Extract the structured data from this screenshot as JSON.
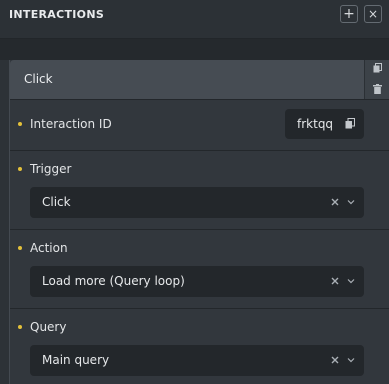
{
  "panel": {
    "title": "INTERACTIONS",
    "add_icon": "plus-icon",
    "close_icon": "close-icon"
  },
  "interaction": {
    "header_label": "Click",
    "copy_icon": "copy-icon",
    "delete_icon": "trash-icon",
    "id_field": {
      "label": "Interaction ID",
      "value": "frktqq",
      "icon": "copy-icon"
    },
    "trigger": {
      "label": "Trigger",
      "value": "Click"
    },
    "action": {
      "label": "Action",
      "value": "Load more (Query loop)"
    },
    "query": {
      "label": "Query",
      "value": "Main query"
    }
  },
  "colors": {
    "required_dot": "#e4c13a",
    "field_bg": "#23272b",
    "header_bg": "#464c53"
  }
}
